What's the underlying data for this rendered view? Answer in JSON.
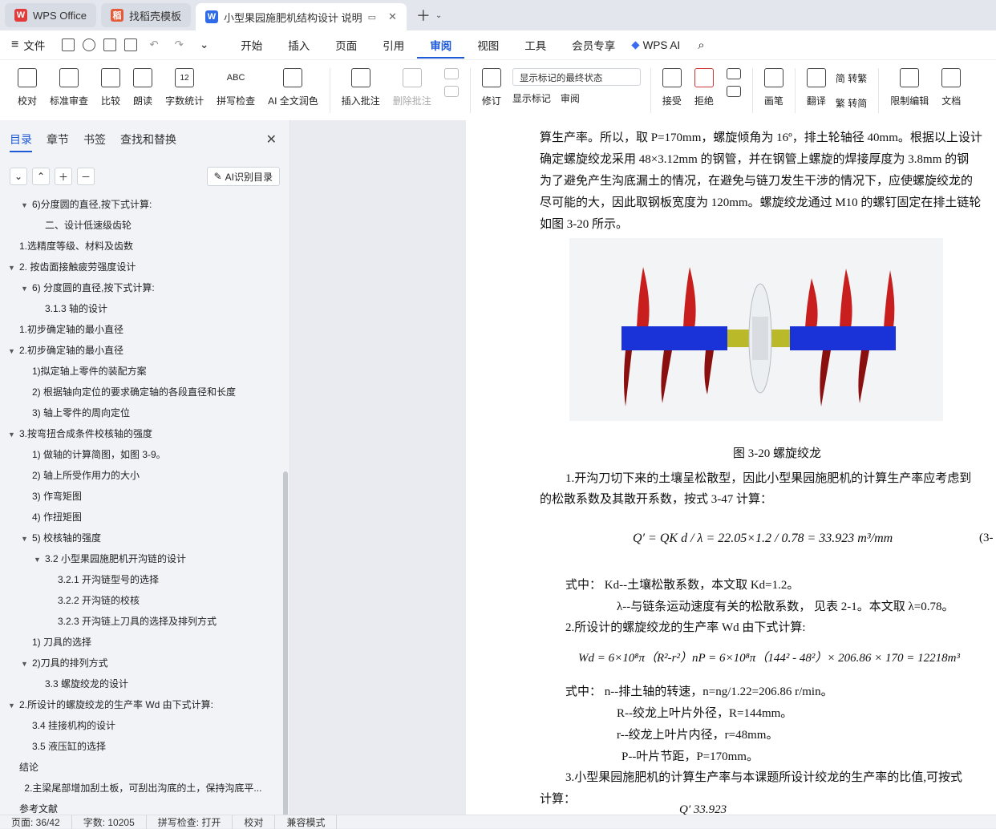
{
  "tabs": [
    {
      "label": "WPS Office",
      "logo": "W"
    },
    {
      "label": "找稻壳模板",
      "logo": "稻"
    },
    {
      "label": "小型果园施肥机结构设计 说明",
      "logo": "W"
    }
  ],
  "menu": {
    "file": "文件",
    "items": [
      "开始",
      "插入",
      "页面",
      "引用",
      "审阅",
      "视图",
      "工具",
      "会员专享"
    ],
    "wps_ai": "WPS AI"
  },
  "ribbon": {
    "proofread": "校对",
    "standard_review": "标准审查",
    "compare": "比较",
    "read_aloud": "朗读",
    "word_count": "字数统计",
    "spell_check": "拼写检查",
    "ai_polish": "AI 全文润色",
    "insert_comment": "插入批注",
    "delete_comment": "删除批注",
    "track": "修订",
    "markup_select": "显示标记的最终状态",
    "show_markup": "显示标记",
    "review": "审阅",
    "accept": "接受",
    "reject": "拒绝",
    "pen": "画笔",
    "translate": "翻译",
    "to_trad": "简 转繁",
    "to_simp": "繁 转简",
    "restrict": "限制编辑",
    "doc_more": "文档"
  },
  "sidebar": {
    "tabs": [
      "目录",
      "章节",
      "书签",
      "查找和替换"
    ],
    "ai_toc": "AI识别目录",
    "toc": [
      {
        "t": "6)分度圆的直径,按下式计算:",
        "l": 2,
        "a": "▼"
      },
      {
        "t": "二、设计低速级齿轮",
        "l": 3,
        "a": ""
      },
      {
        "t": "1.选精度等级、材料及齿数",
        "l": 1,
        "a": ""
      },
      {
        "t": "2. 按齿面接触疲劳强度设计",
        "l": 1,
        "a": "▼"
      },
      {
        "t": "6) 分度圆的直径,按下式计算:",
        "l": 2,
        "a": "▼"
      },
      {
        "t": "3.1.3 轴的设计",
        "l": 3,
        "a": ""
      },
      {
        "t": "1.初步确定轴的最小直径",
        "l": 1,
        "a": ""
      },
      {
        "t": "2.初步确定轴的最小直径",
        "l": 1,
        "a": "▼"
      },
      {
        "t": "1)拟定轴上零件的装配方案",
        "l": 2,
        "a": ""
      },
      {
        "t": "2) 根据轴向定位的要求确定轴的各段直径和长度",
        "l": 2,
        "a": ""
      },
      {
        "t": "3) 轴上零件的周向定位",
        "l": 2,
        "a": ""
      },
      {
        "t": "3.按弯扭合成条件校核轴的强度",
        "l": 1,
        "a": "▼"
      },
      {
        "t": "1) 做轴的计算简图，如图 3-9。",
        "l": 2,
        "a": ""
      },
      {
        "t": "2) 轴上所受作用力的大小",
        "l": 2,
        "a": ""
      },
      {
        "t": "3) 作弯矩图",
        "l": 2,
        "a": ""
      },
      {
        "t": "4) 作扭矩图",
        "l": 2,
        "a": ""
      },
      {
        "t": "5) 校核轴的强度",
        "l": 2,
        "a": "▼"
      },
      {
        "t": "3.2 小型果园施肥机开沟链的设计",
        "l": 3,
        "a": "▼"
      },
      {
        "t": "3.2.1 开沟链型号的选择",
        "l": 4,
        "a": ""
      },
      {
        "t": "3.2.2 开沟链的校核",
        "l": 4,
        "a": ""
      },
      {
        "t": "3.2.3 开沟链上刀具的选择及排列方式",
        "l": 4,
        "a": ""
      },
      {
        "t": "1) 刀具的选择",
        "l": 2,
        "a": ""
      },
      {
        "t": "2)刀具的排列方式",
        "l": 2,
        "a": "▼"
      },
      {
        "t": "3.3 螺旋绞龙的设计",
        "l": 3,
        "a": ""
      },
      {
        "t": "2.所设计的螺旋绞龙的生产率 Wd 由下式计算:",
        "l": 1,
        "a": "▼"
      },
      {
        "t": "3.4 挂接机构的设计",
        "l": 2,
        "a": ""
      },
      {
        "t": "3.5 液压缸的选择",
        "l": 2,
        "a": ""
      },
      {
        "t": "结论",
        "l": 1,
        "a": ""
      },
      {
        "t": "2.主梁尾部增加刮土板，可刮出沟底的土，保持沟底平...",
        "l": 1.4,
        "a": ""
      },
      {
        "t": "参考文献",
        "l": 1,
        "a": ""
      }
    ]
  },
  "doc": {
    "l1": "算生产率。所以，取 P=170mm，螺旋倾角为 16º，排土轮轴径 40mm。根据以上设计",
    "l2": "确定螺旋绞龙采用 48×3.12mm 的钢管，并在钢管上螺旋的焊接厚度为 3.8mm 的钢",
    "l3": "为了避免产生沟底漏土的情况，在避免与链刀发生干涉的情况下，应使螺旋绞龙的",
    "l4": "尽可能的大，因此取钢板宽度为 120mm。螺旋绞龙通过 M10 的螺钉固定在排土链轮",
    "l5": "如图 3-20 所示。",
    "caption": "图 3-20  螺旋绞龙",
    "p1a": "1.开沟刀切下来的土壤呈松散型，因此小型果园施肥机的计算生产率应考虑到",
    "p1b": "的松散系数及其散开系数，按式 3-47 计算：",
    "f1": "Q′ = QK d / λ = 22.05×1.2 / 0.78 = 33.923 m³/mm",
    "f1no": "(3-",
    "w1": "式中：   Kd--土壤松散系数，本文取 Kd=1.2。",
    "w2": "λ--与链条运动速度有关的松散系数， 见表 2-1。本文取 λ=0.78。",
    "p2": "2.所设计的螺旋绞龙的生产率 Wd 由下式计算:",
    "f2": "Wd = 6×10⁸π（R²-r²）nP = 6×10⁸π（144² - 48²）× 206.86 × 170 = 12218m³",
    "w3": "式中：   n--排土轴的转速，n=ng/1.22=206.86 r/min。",
    "w4": "R--绞龙上叶片外径，R=144mm。",
    "w5": "r--绞龙上叶片内径，r=48mm。",
    "w6": "P--叶片节距，P=170mm。",
    "p3a": "3.小型果园施肥机的计算生产率与本课题所设计绞龙的生产率的比值,可按式",
    "p3b": "计算：",
    "f3": "Q′     33.923"
  },
  "status": {
    "page": "页面: 36/42",
    "words": "字数: 10205",
    "spell": "拼写检查: 打开",
    "proof": "校对",
    "compat": "兼容模式"
  }
}
